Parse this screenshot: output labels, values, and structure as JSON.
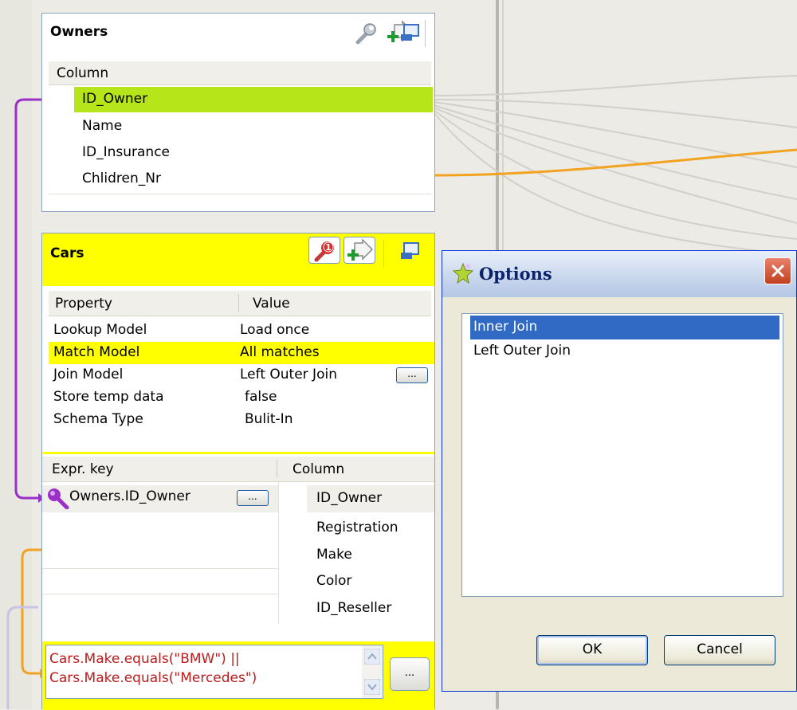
{
  "owners": {
    "title": "Owners",
    "column_header": "Column",
    "columns": [
      "ID_Owner",
      "Name",
      "ID_Insurance",
      "Chlidren_Nr"
    ]
  },
  "cars": {
    "title": "Cars",
    "properties_header": {
      "property": "Property",
      "value": "Value"
    },
    "properties": [
      {
        "property": "Lookup Model",
        "value": "Load once"
      },
      {
        "property": "Match Model",
        "value": "All matches"
      },
      {
        "property": "Join Model",
        "value": "Left Outer Join"
      },
      {
        "property": "Store temp data",
        "value": "false"
      },
      {
        "property": "Schema Type",
        "value": "Bulit-In"
      }
    ],
    "expr_header": {
      "expr_key": "Expr. key",
      "column": "Column"
    },
    "expr_key": "Owners.ID_Owner",
    "columns": [
      "ID_Owner",
      "Registration",
      "Make",
      "Color",
      "ID_Reseller"
    ],
    "filter_line1": "Cars.Make.equals(\"BMW\") ||",
    "filter_line2": "Cars.Make.equals(\"Mercedes\")",
    "dots_label": "...",
    "warning_count": "1"
  },
  "dialog": {
    "title": "Options",
    "options": [
      "Inner Join",
      "Left Outer Join"
    ],
    "selected_index": 0,
    "ok_label": "OK",
    "cancel_label": "Cancel"
  },
  "colors": {
    "selection_green": "#b6e619",
    "highlight_yellow": "#ffff00",
    "link_purple": "#9b30c8",
    "link_orange": "#f2a321",
    "xp_blue": "#316ac5"
  },
  "icons": [
    "wrench-icon",
    "add-output-icon",
    "minimize-icon",
    "error-key-icon",
    "key-icon",
    "options-star-icon",
    "close-icon",
    "scroll-up-icon",
    "scroll-down-icon"
  ]
}
